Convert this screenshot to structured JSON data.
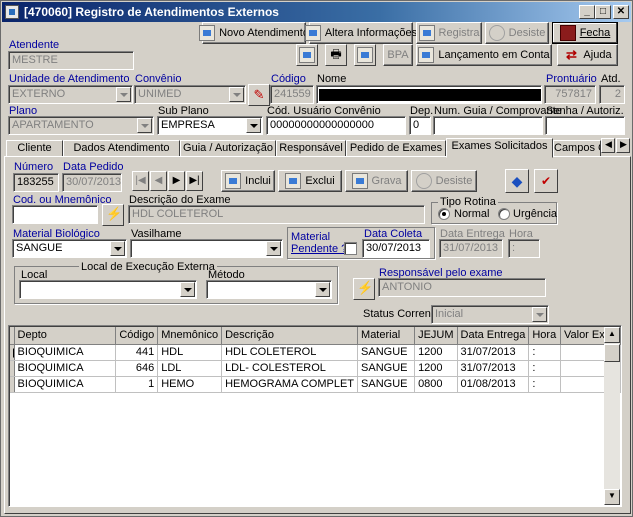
{
  "window": {
    "title": "[470060] Registro de Atendimentos Externos",
    "min": "_",
    "max": "□",
    "close": "✕"
  },
  "toolbar": {
    "novo": "Novo Atendimento",
    "altera": "Altera Informações",
    "registra": "Registra",
    "desiste": "Desiste",
    "fecha": "Fecha",
    "bpa": "BPA",
    "lancamento": "Lançamento em Conta",
    "ajuda": "Ajuda"
  },
  "header": {
    "atendente_label": "Atendente",
    "atendente_value": "MESTRE",
    "unidade_label": "Unidade de Atendimento",
    "unidade_value": "EXTERNO",
    "convenio_label": "Convênio",
    "convenio_value": "UNIMED",
    "codigo_label": "Código",
    "codigo_value": "241559",
    "nome_label": "Nome",
    "prontuario_label": "Prontuário",
    "prontuario_value": "757817",
    "atd_label": "Atd.",
    "atd_value": "2",
    "plano_label": "Plano",
    "plano_value": "APARTAMENTO",
    "subplano_label": "Sub Plano",
    "subplano_value": "EMPRESA",
    "codusuario_label": "Cód. Usuário Convênio",
    "codusuario_value": "00000000000000000",
    "dep_label": "Dep.",
    "dep_value": "0",
    "numguia_label": "Num. Guia / Comprovante",
    "numguia_value": "",
    "senha_label": "Senha / Autoriz.",
    "senha_value": ""
  },
  "tabs": [
    "Cliente",
    "Dados Atendimento",
    "Guia / Autorização",
    "Responsável",
    "Pedido de Exames",
    "Exames Solicitados",
    "Campos C"
  ],
  "active_tab": "Exames Solicitados",
  "exam": {
    "numero_label": "Número",
    "numero_value": "183255",
    "datapedido_label": "Data Pedido",
    "datapedido_value": "30/07/2013",
    "nav": [
      "|◀",
      "◀",
      "▶",
      "▶|"
    ],
    "inclui": "Inclui",
    "exclui": "Exclui",
    "grava": "Grava",
    "desiste": "Desiste",
    "codmnem_label": "Cod. ou Mnemônico",
    "codmnem_value": "",
    "descricao_label": "Descrição do Exame",
    "descricao_value": "HDL COLETEROL",
    "tiporotina_label": "Tipo Rotina",
    "normal_label": "Normal",
    "urgencia_label": "Urgência",
    "material_label": "Material Biológico",
    "material_value": "SANGUE",
    "vasilhame_label": "Vasilhame",
    "vasilhame_value": "",
    "matpend_label1": "Material",
    "matpend_label2": "Pendente ?",
    "datacoleta_label": "Data Coleta",
    "datacoleta_value": "30/07/2013",
    "dataentrega_label": "Data Entrega",
    "dataentrega_value": "31/07/2013",
    "hora_label": "Hora",
    "hora_value": ":",
    "local_group_label": "Local de Execução Externa",
    "local_label": "Local",
    "local_value": "",
    "metodo_label": "Método",
    "metodo_value": "",
    "responsavel_label": "Responsável pelo exame",
    "responsavel_value": "ANTONIO",
    "status_label": "Status Corrente:",
    "status_value": "Inicial"
  },
  "grid": {
    "columns": [
      "Depto",
      "Código",
      "Mnemônico",
      "Descrição",
      "Material",
      "JEJUM",
      "Data Entrega",
      "Hora",
      "Valor Exan"
    ],
    "rows": [
      [
        "BIOQUIMICA",
        "441",
        "HDL",
        "HDL COLETEROL",
        "SANGUE",
        "1200",
        "31/07/2013",
        ":",
        ""
      ],
      [
        "BIOQUIMICA",
        "646",
        "LDL",
        "LDL- COLESTEROL",
        "SANGUE",
        "1200",
        "31/07/2013",
        ":",
        ""
      ],
      [
        "BIOQUIMICA",
        "1",
        "HEMO",
        "HEMOGRAMA COMPLET",
        "SANGUE",
        "0800",
        "01/08/2013",
        ":",
        ""
      ]
    ]
  }
}
